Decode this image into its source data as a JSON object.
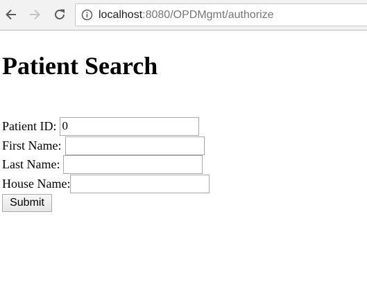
{
  "browser": {
    "url_host": "localhost",
    "url_rest": ":8080/OPDMgmt/authorize",
    "back_icon": "back-arrow-icon",
    "forward_icon": "forward-arrow-icon",
    "reload_icon": "reload-icon",
    "info_icon": "info-icon"
  },
  "page": {
    "title": "Patient Search",
    "fields": {
      "patient_id": {
        "label": "Patient ID:",
        "value": "0"
      },
      "first_name": {
        "label": "First Name:",
        "value": ""
      },
      "last_name": {
        "label": "Last Name:",
        "value": ""
      },
      "house_name": {
        "label": "House Name:",
        "value": ""
      }
    },
    "submit_label": "Submit"
  },
  "colors": {
    "toolbar_bg": "#f2f2f2",
    "url_host": "#202020",
    "url_path": "#767676",
    "input_border": "#a9a9a9"
  }
}
